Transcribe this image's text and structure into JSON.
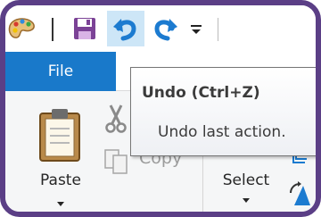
{
  "quick_access_toolbar": {
    "items": [
      {
        "icon": "paint-app-icon"
      },
      {
        "icon": "save-icon"
      },
      {
        "icon": "undo-icon"
      },
      {
        "icon": "redo-icon"
      },
      {
        "icon": "customize-toolbar-icon"
      }
    ]
  },
  "ribbon": {
    "file_tab_label": "File",
    "clipboard": {
      "paste_label": "Paste",
      "cut_icon": "cut-icon",
      "copy_label": "Copy"
    },
    "image": {
      "select_label": "Select"
    }
  },
  "tooltip": {
    "title": "Undo (Ctrl+Z)",
    "description": "Undo last action."
  },
  "colors": {
    "file_tab": "#1979ca",
    "frame": "#5b3f86",
    "hover": "#cde6f7",
    "undo_arrow": "#1c7bd0"
  }
}
